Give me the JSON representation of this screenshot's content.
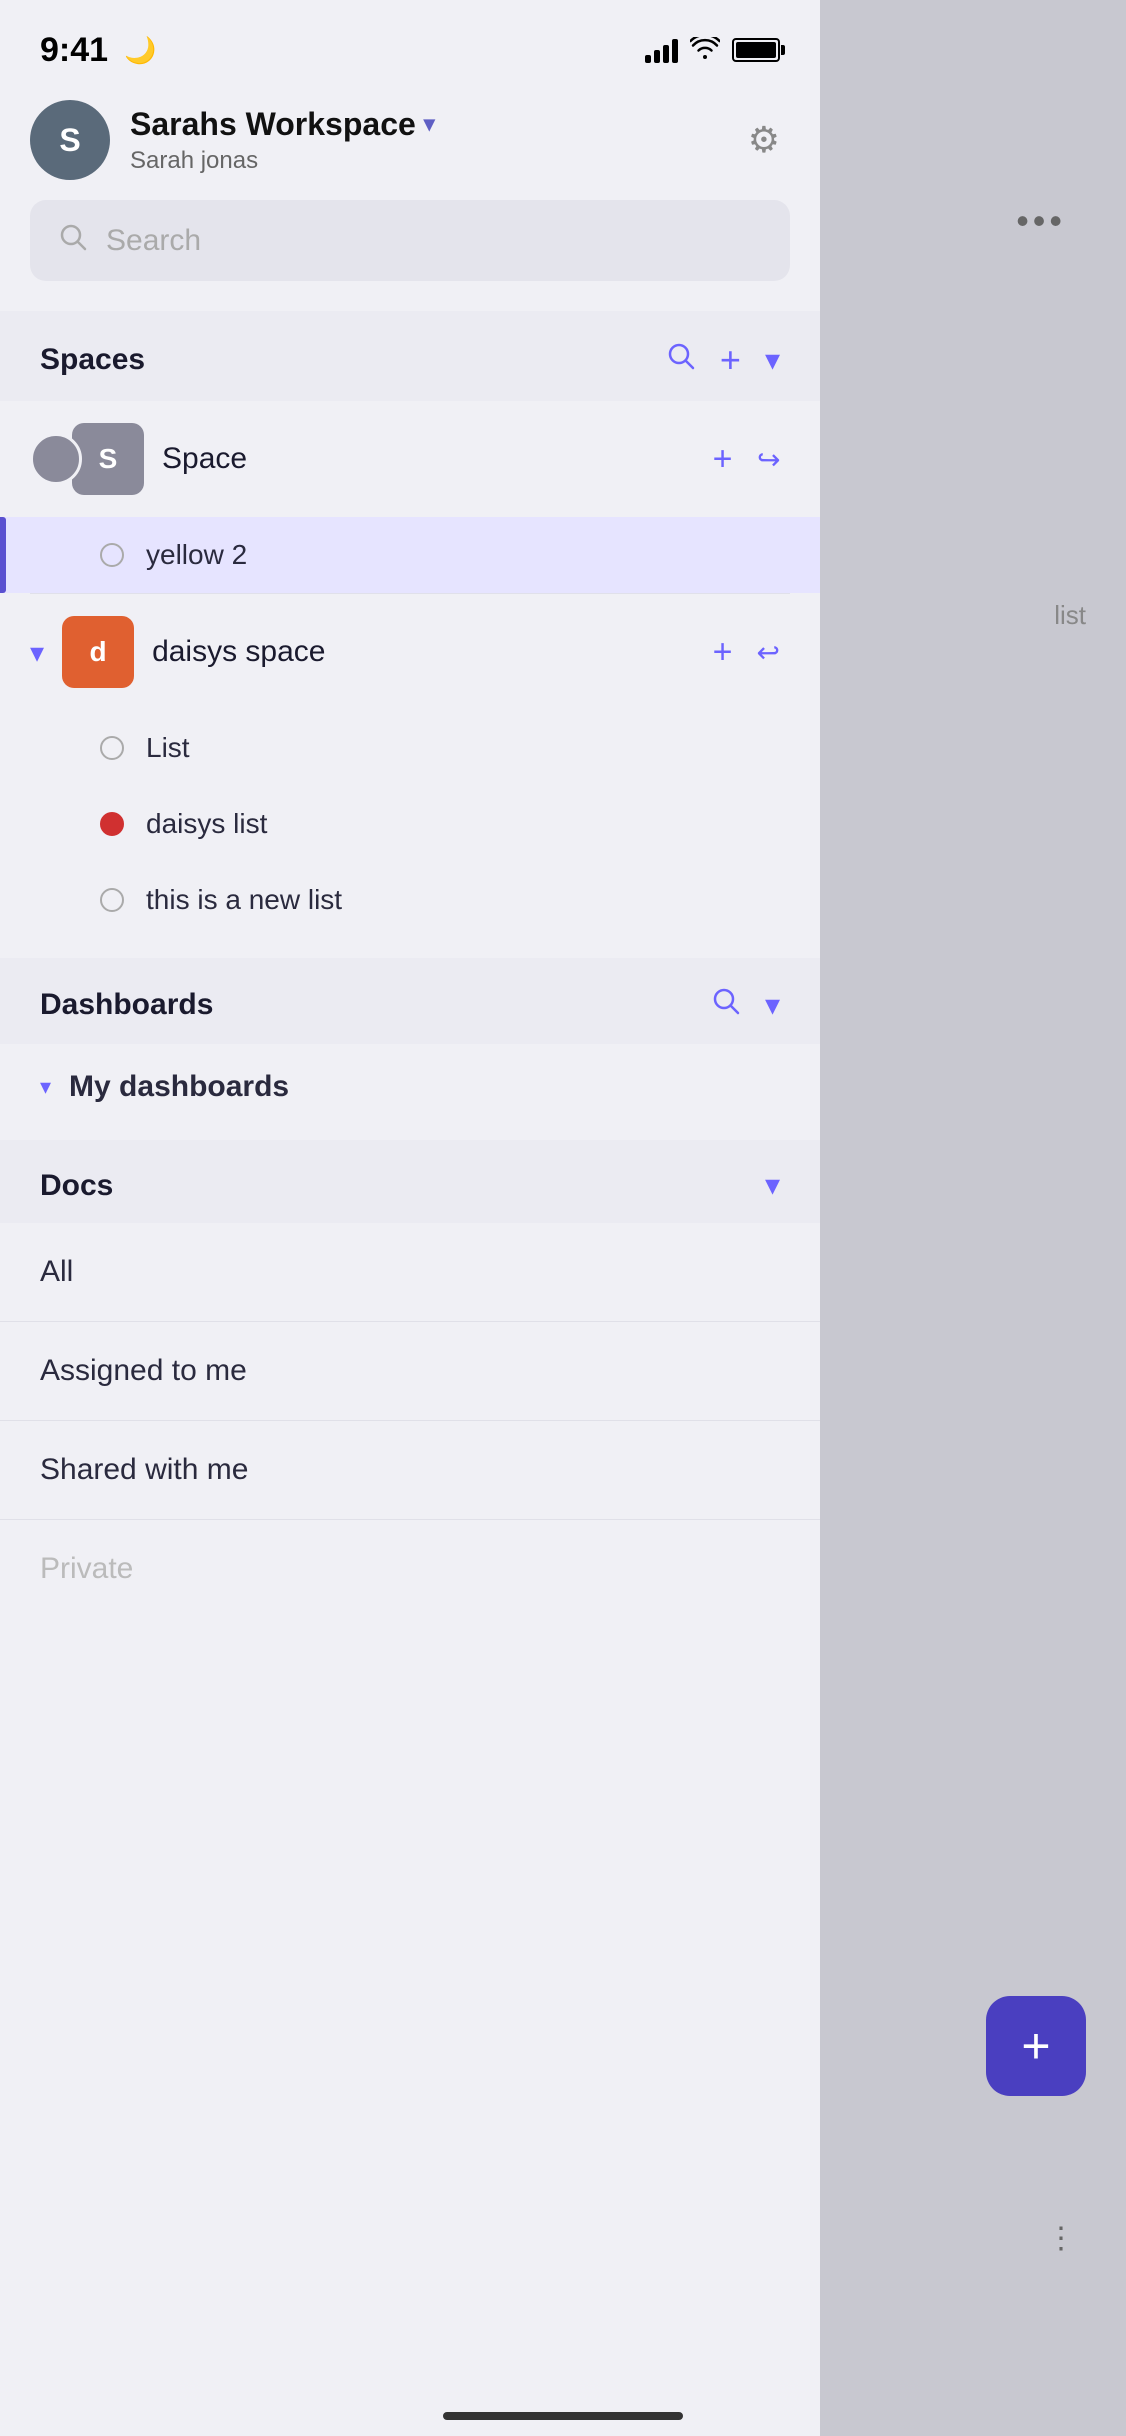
{
  "statusBar": {
    "time": "9:41",
    "moonIcon": "🌙"
  },
  "header": {
    "avatarLabel": "S",
    "workspaceName": "Sarahs Workspace",
    "userName": "Sarah jonas",
    "settingsIcon": "⚙"
  },
  "search": {
    "placeholder": "Search"
  },
  "spaces": {
    "sectionTitle": "Spaces",
    "items": [
      {
        "id": "space",
        "label": "S",
        "name": "Space",
        "avatarColor": "gray",
        "lists": [
          {
            "name": "yellow 2",
            "dotStyle": "empty",
            "highlighted": true
          }
        ]
      },
      {
        "id": "daisys-space",
        "label": "d",
        "name": "daisys space",
        "avatarColor": "orange",
        "expanded": true,
        "lists": [
          {
            "name": "List",
            "dotStyle": "empty",
            "highlighted": false
          },
          {
            "name": "daisys list",
            "dotStyle": "red",
            "highlighted": false
          },
          {
            "name": "this is a new list",
            "dotStyle": "empty",
            "highlighted": false
          }
        ]
      }
    ]
  },
  "dashboards": {
    "sectionTitle": "Dashboards",
    "items": [
      {
        "name": "My dashboards"
      }
    ]
  },
  "docs": {
    "sectionTitle": "Docs",
    "items": [
      {
        "name": "All"
      },
      {
        "name": "Assigned to me"
      },
      {
        "name": "Shared with me"
      },
      {
        "name": "Private"
      }
    ]
  },
  "fab": {
    "label": "+"
  },
  "rightPanel": {
    "text": "list"
  },
  "icons": {
    "search": "○",
    "plus": "+",
    "chevronDown": "∨",
    "chevronDownFilled": "▾",
    "logout": "↪",
    "dots": "•••"
  }
}
